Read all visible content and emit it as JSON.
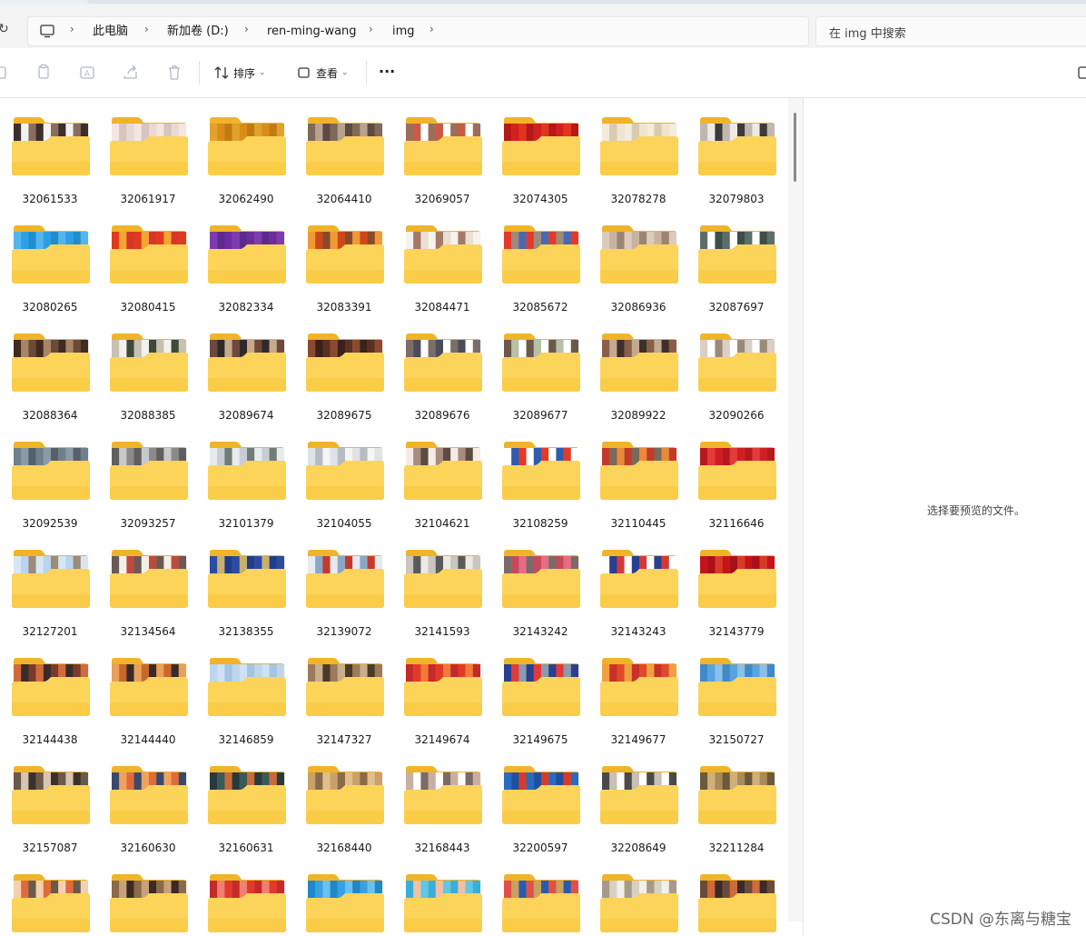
{
  "titlebar": {
    "breadcrumb": [
      "此电脑",
      "新加卷 (D:)",
      "ren-ming-wang",
      "img"
    ],
    "search_placeholder": "在 img 中搜索"
  },
  "toolbar": {
    "sort_label": "排序",
    "view_label": "查看",
    "more_label": "···"
  },
  "preview": {
    "empty_text": "选择要预览的文件。"
  },
  "watermark": "CSDN @东离与糖宝",
  "folders": [
    {
      "name": "32061533",
      "colors": [
        "#3b2f2c",
        "#f2f2f2",
        "#8a6d5f"
      ]
    },
    {
      "name": "32061917",
      "colors": [
        "#e8d9d6",
        "#f3e6e2",
        "#d7c4bf"
      ]
    },
    {
      "name": "32062490",
      "colors": [
        "#d98c17",
        "#c47a12",
        "#e0a22c"
      ]
    },
    {
      "name": "32064410",
      "colors": [
        "#7f6a5a",
        "#b8a38e",
        "#5e4a40"
      ]
    },
    {
      "name": "32069057",
      "colors": [
        "#ffffff",
        "#9c6e5a",
        "#c95b45"
      ]
    },
    {
      "name": "32074305",
      "colors": [
        "#d2201f",
        "#e1351e",
        "#b51818"
      ]
    },
    {
      "name": "32078278",
      "colors": [
        "#f3ecdd",
        "#d9cbb0",
        "#efe5cf"
      ]
    },
    {
      "name": "32079803",
      "colors": [
        "#3c3a3a",
        "#c0b7b0",
        "#efe9e4"
      ]
    },
    {
      "name": "32080265",
      "colors": [
        "#2aa0e6",
        "#1c8ecf",
        "#54b4ec"
      ]
    },
    {
      "name": "32080415",
      "colors": [
        "#e03a1c",
        "#f3a52f",
        "#d7342a"
      ]
    },
    {
      "name": "32082334",
      "colors": [
        "#6e2ba0",
        "#7d3bb0",
        "#5c2a8d"
      ]
    },
    {
      "name": "32083391",
      "colors": [
        "#d0481a",
        "#8a4a2a",
        "#f09a36"
      ]
    },
    {
      "name": "32084471",
      "colors": [
        "#f6f2ee",
        "#a37a64",
        "#e9dfd6"
      ]
    },
    {
      "name": "32085672",
      "colors": [
        "#4a67b0",
        "#e23a2a",
        "#9c8a7a"
      ]
    },
    {
      "name": "32086936",
      "colors": [
        "#c8b3a1",
        "#9c8472",
        "#dccbbd"
      ]
    },
    {
      "name": "32087697",
      "colors": [
        "#5c6e6a",
        "#ffffff",
        "#3d4d49"
      ]
    },
    {
      "name": "32088364",
      "colors": [
        "#6b4a37",
        "#3f2b22",
        "#a98566"
      ]
    },
    {
      "name": "32088385",
      "colors": [
        "#f4f1ec",
        "#3e4a3a",
        "#c8c0b2"
      ]
    },
    {
      "name": "32089674",
      "colors": [
        "#6e4a3c",
        "#2f2a2a",
        "#c6a98e"
      ]
    },
    {
      "name": "32089675",
      "colors": [
        "#5a3022",
        "#8a4a30",
        "#3b2119"
      ]
    },
    {
      "name": "32089676",
      "colors": [
        "#4b4c5a",
        "#ffffff",
        "#7a6d6a"
      ]
    },
    {
      "name": "32089677",
      "colors": [
        "#6a5a4a",
        "#b8c1a6",
        "#ffffff"
      ]
    },
    {
      "name": "32089922",
      "colors": [
        "#3f2f2a",
        "#8a5f4a",
        "#c3a98f"
      ]
    },
    {
      "name": "32090266",
      "colors": [
        "#ffffff",
        "#9b8a7a",
        "#d9cfc4"
      ]
    },
    {
      "name": "32092539",
      "colors": [
        "#6f7f8c",
        "#8a9aa6",
        "#54606b"
      ]
    },
    {
      "name": "32093257",
      "colors": [
        "#8a8a8a",
        "#5f5f5f",
        "#c9c9c9"
      ]
    },
    {
      "name": "32101379",
      "colors": [
        "#c8cdd4",
        "#6f7c7a",
        "#e6ebef"
      ]
    },
    {
      "name": "32104055",
      "colors": [
        "#dfe3e8",
        "#b6bcc2",
        "#f3f5f7"
      ]
    },
    {
      "name": "32104621",
      "colors": [
        "#5a4b44",
        "#f5ede5",
        "#a88d7d"
      ]
    },
    {
      "name": "32108259",
      "colors": [
        "#2f5bb0",
        "#e23a2a",
        "#ffffff"
      ]
    },
    {
      "name": "32110445",
      "colors": [
        "#c43a2a",
        "#7a6a5a",
        "#e88a3a"
      ]
    },
    {
      "name": "32116646",
      "colors": [
        "#d01f24",
        "#b7181d",
        "#e33a3a"
      ]
    },
    {
      "name": "32127201",
      "colors": [
        "#b9d4ee",
        "#9c8a7a",
        "#d6e6f5"
      ]
    },
    {
      "name": "32134564",
      "colors": [
        "#6a5a56",
        "#f3efe9",
        "#c04a3a"
      ]
    },
    {
      "name": "32138355",
      "colors": [
        "#1f3d8f",
        "#2a4aa3",
        "#c8b06a"
      ]
    },
    {
      "name": "32139072",
      "colors": [
        "#8aa7c9",
        "#c43a2a",
        "#e6ebf0"
      ]
    },
    {
      "name": "32141593",
      "colors": [
        "#c9c5c0",
        "#5a5a5a",
        "#ece8e3"
      ]
    },
    {
      "name": "32143242",
      "colors": [
        "#e86a86",
        "#7a6a6a",
        "#c44a5a"
      ]
    },
    {
      "name": "32143243",
      "colors": [
        "#2a3f8f",
        "#d23a3a",
        "#ffffff"
      ]
    },
    {
      "name": "32143779",
      "colors": [
        "#c5131a",
        "#a8101a",
        "#d83a2a"
      ]
    },
    {
      "name": "32144438",
      "colors": [
        "#7a3a2a",
        "#d06a3a",
        "#3a2a2a"
      ]
    },
    {
      "name": "32144440",
      "colors": [
        "#c8682a",
        "#3a2a2a",
        "#e8a05a"
      ]
    },
    {
      "name": "32146859",
      "colors": [
        "#bcd6ee",
        "#cfe2f3",
        "#a3c4e4"
      ]
    },
    {
      "name": "32147327",
      "colors": [
        "#4a3a2a",
        "#9c7a5a",
        "#c8b08a"
      ]
    },
    {
      "name": "32149674",
      "colors": [
        "#e23a2a",
        "#f07a3a",
        "#c42a2a"
      ]
    },
    {
      "name": "32149675",
      "colors": [
        "#2a3f8f",
        "#e23a3a",
        "#8a9ab0"
      ]
    },
    {
      "name": "32149677",
      "colors": [
        "#e04a2a",
        "#f0a040",
        "#c8302a"
      ]
    },
    {
      "name": "32150727",
      "colors": [
        "#5aa3e0",
        "#8ac0ea",
        "#3f89cc"
      ]
    },
    {
      "name": "32157087",
      "colors": [
        "#6a5a4a",
        "#d8c4b0",
        "#3a322a"
      ]
    },
    {
      "name": "32160630",
      "colors": [
        "#e06a3a",
        "#3a4a6a",
        "#f0a060"
      ]
    },
    {
      "name": "32160631",
      "colors": [
        "#3a5a5a",
        "#c86a3a",
        "#2a3a3a"
      ]
    },
    {
      "name": "32168440",
      "colors": [
        "#c8a06a",
        "#8a6a4a",
        "#e0c08a"
      ]
    },
    {
      "name": "32168443",
      "colors": [
        "#7a6a6a",
        "#c8b0a0",
        "#ffffff"
      ]
    },
    {
      "name": "32200597",
      "colors": [
        "#1f4f9f",
        "#d83a2a",
        "#2a6ac0"
      ]
    },
    {
      "name": "32208649",
      "colors": [
        "#4a4a4a",
        "#c8c0b4",
        "#ffffff"
      ]
    },
    {
      "name": "32211284",
      "colors": [
        "#a88a5a",
        "#6a5a3a",
        "#d0b07a"
      ]
    },
    {
      "name": "",
      "colors": [
        "#e06a3a",
        "#6a5a4a",
        "#f2d0b0"
      ]
    },
    {
      "name": "",
      "colors": [
        "#8a6a4a",
        "#c8a07a",
        "#3a2a22"
      ]
    },
    {
      "name": "",
      "colors": [
        "#e23a2a",
        "#c42a2a",
        "#f08070"
      ]
    },
    {
      "name": "",
      "colors": [
        "#3aa0e0",
        "#6ac0ee",
        "#1f88c8"
      ]
    },
    {
      "name": "",
      "colors": [
        "#3aaed8",
        "#f0c0a0",
        "#62c6e6"
      ]
    },
    {
      "name": "",
      "colors": [
        "#2a5ab0",
        "#e0504a",
        "#c8a060"
      ]
    },
    {
      "name": "",
      "colors": [
        "#d8d0c4",
        "#f0f0f0",
        "#a89a8a"
      ]
    },
    {
      "name": "",
      "colors": [
        "#6a4a3a",
        "#d06a3a",
        "#3a2a2a"
      ]
    }
  ]
}
